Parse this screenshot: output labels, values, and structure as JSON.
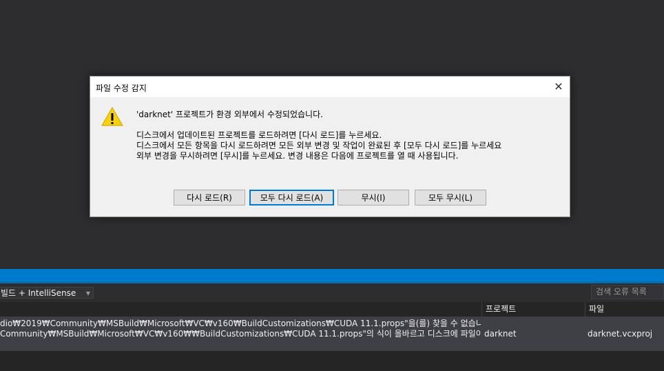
{
  "dialog": {
    "title": "파일 수정 감지",
    "close_symbol": "✕",
    "message_main": "'darknet' 프로젝트가 환경 외부에서 수정되었습니다.",
    "message_lines": [
      "디스크에서 업데이트된 프로젝트를 로드하려면 [다시 로드]를 누르세요.",
      "디스크에서 모든 항목을 다시 로드하려면 모든 외부 변경 및 작업이 완료된 후 [모두 다시 로드]를 누르세요",
      "외부 변경을 무시하려면 [무시]를 누르세요. 변경 내용은 다음에 프로젝트를 열 때 사용됩니다."
    ],
    "buttons": {
      "reload": "다시 로드(R)",
      "reload_all": "모두 다시 로드(A)",
      "ignore": "무시(I)",
      "ignore_all": "모두 무시(L)"
    },
    "icon": "warning-icon"
  },
  "error_list": {
    "filter_value": "빌드 + IntelliSense",
    "search_placeholder": "검색 오류 목록",
    "columns": {
      "project": "프로젝트",
      "file": "파일"
    },
    "rows": [
      {
        "desc_line1": "dio₩2019₩Community₩MSBuild₩Microsoft₩VC₩v160₩BuildCustomizations₩CUDA 11.1.props\"을(를) 찾을 수 없습니다. Import",
        "desc_line2": "Community₩MSBuild₩Microsoft₩VC₩v160₩₩BuildCustomizations₩CUDA 11.1.props\"의 식이 올바르고 디스크에 파일이 있는지",
        "project": "darknet",
        "file": "darknet.vcxproj"
      }
    ]
  },
  "colors": {
    "ide_background": "#2d2d30",
    "status_blue": "#007acc",
    "dialog_background": "#f0f0f0",
    "default_button_border": "#0078d7"
  }
}
